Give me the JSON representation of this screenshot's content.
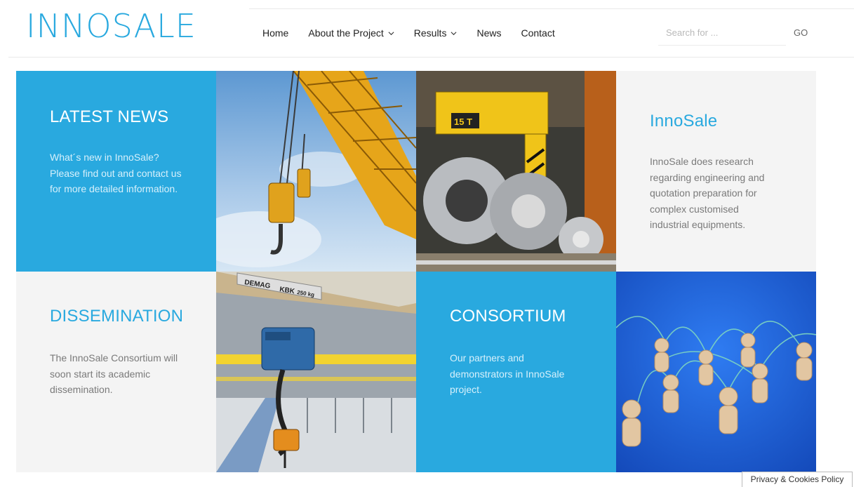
{
  "logo": "INNOSALE",
  "nav": {
    "home": "Home",
    "about": "About the Project",
    "results": "Results",
    "news": "News",
    "contact": "Contact"
  },
  "search": {
    "placeholder": "Search for ...",
    "go_label": "GO"
  },
  "tiles": {
    "latest_news": {
      "title": "LATEST NEWS",
      "text": "What´s new in InnoSale? Please find out and contact us for more detailed information."
    },
    "innosale": {
      "title": "InnoSale",
      "text": "InnoSale does research regarding engineering and quotation preparation for complex customised industrial equipments."
    },
    "dissemination": {
      "title": "DISSEMINATION",
      "text": "The InnoSale Consortium will soon start its academic dissemination."
    },
    "consortium": {
      "title": "CONSORTIUM",
      "text": "Our partners and demonstrators in InnoSale project."
    }
  },
  "images": {
    "crane_sign_1": "15 T",
    "hoist_sign_brand": "DEMAG",
    "hoist_sign_model": "KBK",
    "hoist_sign_load": "250 kg"
  },
  "privacy_label": "Privacy & Cookies Policy",
  "colors": {
    "accent": "#29a9df",
    "tile_grey": "#f4f4f4"
  }
}
